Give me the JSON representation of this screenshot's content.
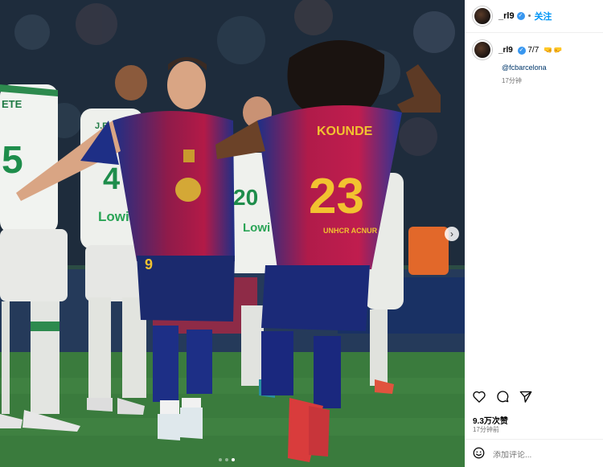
{
  "post": {
    "username": "_rl9",
    "follow_label": "关注",
    "caption_counter": "7/7",
    "caption_emoji": "🤜🤛",
    "mention": "@fcbarcelona",
    "caption_time": "17分钟",
    "likes": "9.3万次赞",
    "time_ago": "17分钟前",
    "comment_placeholder": "添加评论..."
  },
  "photo": {
    "player_left_number": "9",
    "player_right_name": "KOUNDE",
    "player_right_number": "23",
    "player_right_sleeve": "UNHCR ACNUR",
    "opponent_numbers": [
      "5",
      "4",
      "20"
    ],
    "opponent_names": [
      "ETE",
      "J.BER"
    ],
    "opponent_sponsor": "Lowi",
    "carousel_count": 7,
    "carousel_index": 7
  },
  "icons": [
    "avatar",
    "verified-badge",
    "next-arrow-icon",
    "heart-icon",
    "comment-icon",
    "share-icon",
    "emoji-icon"
  ],
  "colors": {
    "accent": "#0095f6",
    "verified": "#3897f0",
    "barca_blue": "#1d2f7a",
    "barca_red": "#a3173f"
  }
}
